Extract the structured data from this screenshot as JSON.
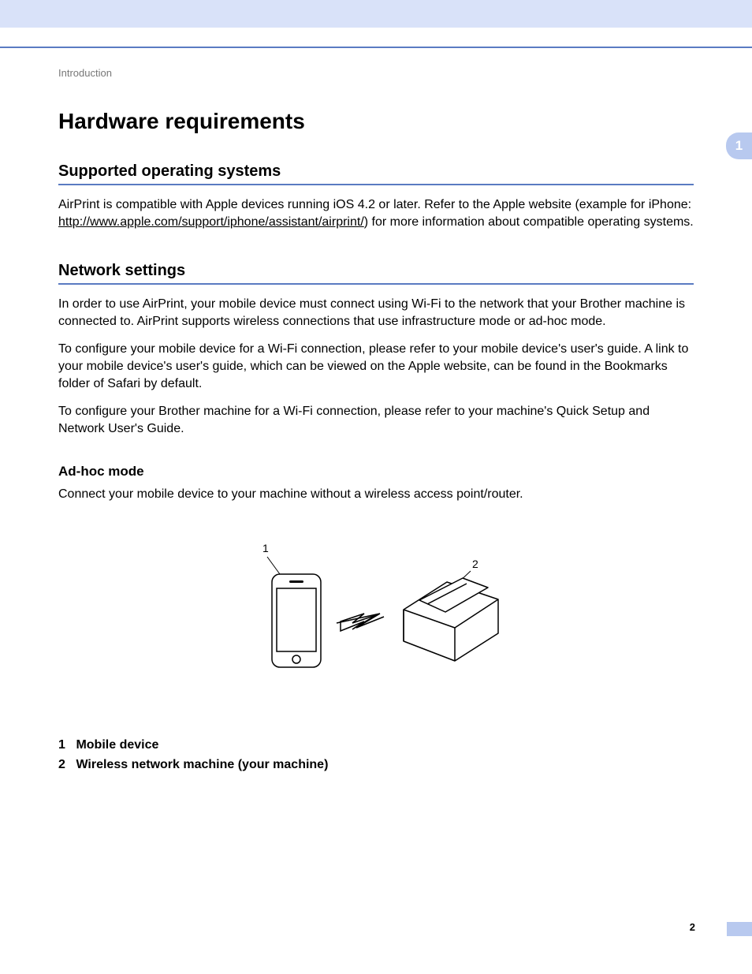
{
  "chapter_number": "1",
  "page_number": "2",
  "breadcrumb": "Introduction",
  "main_heading": "Hardware requirements",
  "section1": {
    "heading": "Supported operating systems",
    "p1_a": "AirPrint is compatible with Apple devices running iOS 4.2 or later. Refer to the Apple website (example for iPhone: ",
    "p1_link": "http://www.apple.com/support/iphone/assistant/airprint/",
    "p1_b": ") for more information about compatible operating systems."
  },
  "section2": {
    "heading": "Network settings",
    "p1": "In order to use AirPrint, your mobile device must connect using Wi-Fi to the network that your Brother machine is connected to. AirPrint supports wireless connections that use infrastructure mode or ad-hoc mode.",
    "p2": "To configure your mobile device for a Wi-Fi connection, please refer to your mobile device's user's guide. A link to your mobile device's user's guide, which can be viewed on the Apple website, can be found in the Bookmarks folder of Safari by default.",
    "p3": "To configure your Brother machine for a Wi-Fi connection, please refer to your machine's Quick Setup and Network User's Guide.",
    "sub_heading": "Ad-hoc mode",
    "sub_p": "Connect your mobile device to your machine without a wireless access point/router."
  },
  "diagram": {
    "label1": "1",
    "label2": "2"
  },
  "legend": {
    "item1_num": "1",
    "item1_text": "Mobile device",
    "item2_num": "2",
    "item2_text": "Wireless network machine (your machine)"
  }
}
